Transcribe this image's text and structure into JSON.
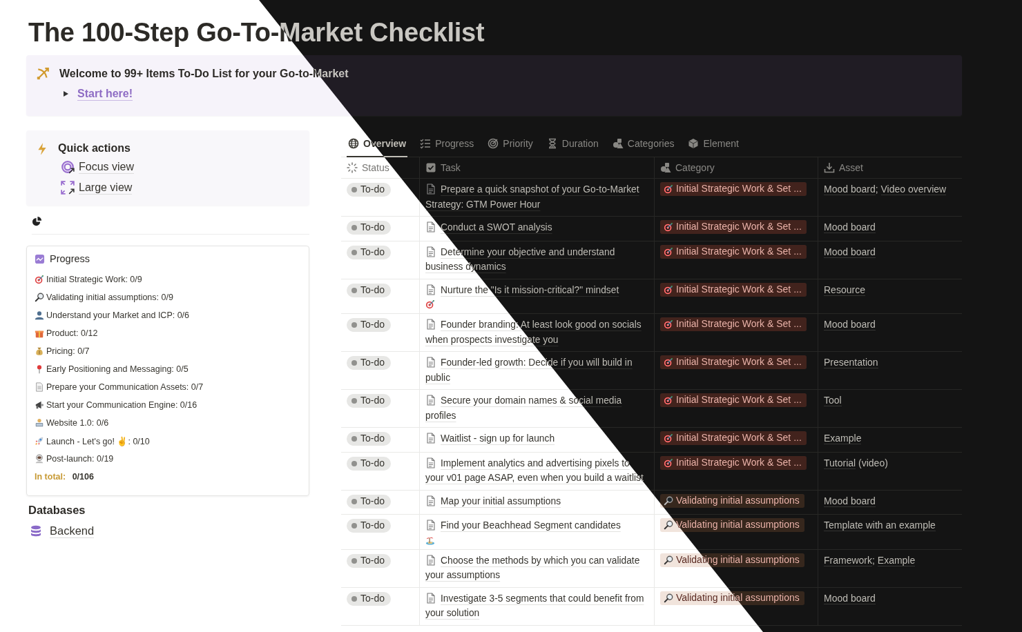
{
  "title": "The 100-Step Go-To-Market Checklist",
  "banner": {
    "text": "Welcome to 99+ Items To-Do List for your Go-to-Market",
    "toggle": {
      "label": "Start here!",
      "expanded": false
    }
  },
  "quick_actions": {
    "title": "Quick actions",
    "items": [
      {
        "kind": "focus",
        "label": "Focus view"
      },
      {
        "kind": "large",
        "label": "Large view"
      }
    ]
  },
  "progress": {
    "title": "Progress",
    "items": [
      {
        "kind": "target",
        "text": "Initial Strategic Work: 0/9"
      },
      {
        "kind": "magnifier",
        "text": "Validating initial assumptions: 0/9"
      },
      {
        "kind": "person",
        "text": "Understand your Market and ICP: 0/6"
      },
      {
        "kind": "gift",
        "text": "Product: 0/12"
      },
      {
        "kind": "moneybag",
        "text": "Pricing: 0/7"
      },
      {
        "kind": "pin",
        "text": "Early Positioning and Messaging: 0/5"
      },
      {
        "kind": "document",
        "text": "Prepare your Communication Assets: 0/7"
      },
      {
        "kind": "megaphone",
        "text": "Start your Communication Engine: 0/16"
      },
      {
        "kind": "laptop",
        "text": "Website 1.0: 0/6"
      },
      {
        "kind": "rocket",
        "text": "Launch - Let's go! ✌: 0/10"
      },
      {
        "kind": "astronaut",
        "text": "Post-launch: 0/19"
      }
    ],
    "total_label": "In total:",
    "total_value": "0/106"
  },
  "databases": {
    "title": "Databases",
    "items": [
      "Backend"
    ]
  },
  "views": [
    {
      "kind": "globe",
      "label": "Overview",
      "selected": true
    },
    {
      "kind": "checklist",
      "label": "Progress",
      "selected": false
    },
    {
      "kind": "target",
      "label": "Priority",
      "selected": false
    },
    {
      "kind": "hourglass",
      "label": "Duration",
      "selected": false
    },
    {
      "kind": "shapes",
      "label": "Categories",
      "selected": false
    },
    {
      "kind": "cube",
      "label": "Element",
      "selected": false
    }
  ],
  "table": {
    "columns": [
      {
        "kind": "status",
        "label": "Status"
      },
      {
        "kind": "checkbox",
        "label": "Task"
      },
      {
        "kind": "shapes",
        "label": "Category"
      },
      {
        "kind": "download",
        "label": "Asset"
      }
    ],
    "rows": [
      {
        "status": "To-do",
        "task": "Prepare a quick snapshot of your Go-to-Market Strategy: GTM Power Hour",
        "category": {
          "kind": "strategic",
          "label": "Initial Strategic Work & Set ..."
        },
        "asset": [
          {
            "kind": "link",
            "text": "Mood board"
          },
          {
            "kind": "separator",
            "text": ";"
          },
          {
            "kind": "link",
            "text": "Video overview"
          }
        ]
      },
      {
        "status": "To-do",
        "task": "Conduct a SWOT analysis",
        "category": {
          "kind": "strategic",
          "label": "Initial Strategic Work & Set ..."
        },
        "asset": [
          {
            "kind": "link",
            "text": "Mood board"
          }
        ]
      },
      {
        "status": "To-do",
        "task": "Determine your objective and understand business dynamics",
        "category": {
          "kind": "strategic",
          "label": "Initial Strategic Work & Set ..."
        },
        "asset": [
          {
            "kind": "link",
            "text": "Mood board"
          }
        ]
      },
      {
        "status": "To-do",
        "task": "Nurture the \"Is it mission-critical?\" mindset",
        "end_icon": {
          "kind": "target"
        },
        "category": {
          "kind": "strategic",
          "label": "Initial Strategic Work & Set ..."
        },
        "asset": [
          {
            "kind": "link",
            "text": "Resource"
          }
        ]
      },
      {
        "status": "To-do",
        "task": "Founder branding: At least look good on socials when prospects investigate you",
        "category": {
          "kind": "strategic",
          "label": "Initial Strategic Work & Set ..."
        },
        "asset": [
          {
            "kind": "link",
            "text": "Mood board"
          }
        ]
      },
      {
        "status": "To-do",
        "task": "Founder-led growth: Decide if you will build in public",
        "category": {
          "kind": "strategic",
          "label": "Initial Strategic Work & Set ..."
        },
        "asset": [
          {
            "kind": "link",
            "text": "Presentation"
          }
        ]
      },
      {
        "status": "To-do",
        "task": "Secure your domain names & social media profiles",
        "category": {
          "kind": "strategic",
          "label": "Initial Strategic Work & Set ..."
        },
        "asset": [
          {
            "kind": "link",
            "text": "Tool"
          }
        ]
      },
      {
        "status": "To-do",
        "task": "Waitlist - sign up for launch",
        "category": {
          "kind": "strategic",
          "label": "Initial Strategic Work & Set ..."
        },
        "asset": [
          {
            "kind": "link",
            "text": "Example"
          }
        ]
      },
      {
        "status": "To-do",
        "task": "Implement analytics and advertising pixels to your v01 page ASAP, even when you build a waitlist",
        "category": {
          "kind": "strategic",
          "label": "Initial Strategic Work & Set ..."
        },
        "asset": [
          {
            "kind": "link",
            "text": "Tutorial"
          },
          {
            "kind": "note",
            "text": "(video)"
          }
        ]
      },
      {
        "status": "To-do",
        "task": "Map your initial assumptions",
        "category": {
          "kind": "validating",
          "label": "Validating initial assumptions"
        },
        "asset": [
          {
            "kind": "link",
            "text": "Mood board"
          }
        ]
      },
      {
        "status": "To-do",
        "task": "Find your Beachhead Segment candidates",
        "end_icon": {
          "kind": "island"
        },
        "category": {
          "kind": "validating",
          "label": "Validating initial assumptions"
        },
        "asset": [
          {
            "kind": "link",
            "text": "Template with an example"
          }
        ]
      },
      {
        "status": "To-do",
        "task": "Choose the methods by which you can validate your assumptions",
        "category": {
          "kind": "validating",
          "label": "Validating initial assumptions"
        },
        "asset": [
          {
            "kind": "link",
            "text": "Framework"
          },
          {
            "kind": "separator",
            "text": ";"
          },
          {
            "kind": "link",
            "text": "Example"
          }
        ]
      },
      {
        "status": "To-do",
        "task": "Investigate 3-5 segments that could benefit from your solution",
        "category": {
          "kind": "validating",
          "label": "Validating initial assumptions"
        },
        "asset": [
          {
            "kind": "link",
            "text": "Mood board"
          }
        ]
      }
    ]
  }
}
